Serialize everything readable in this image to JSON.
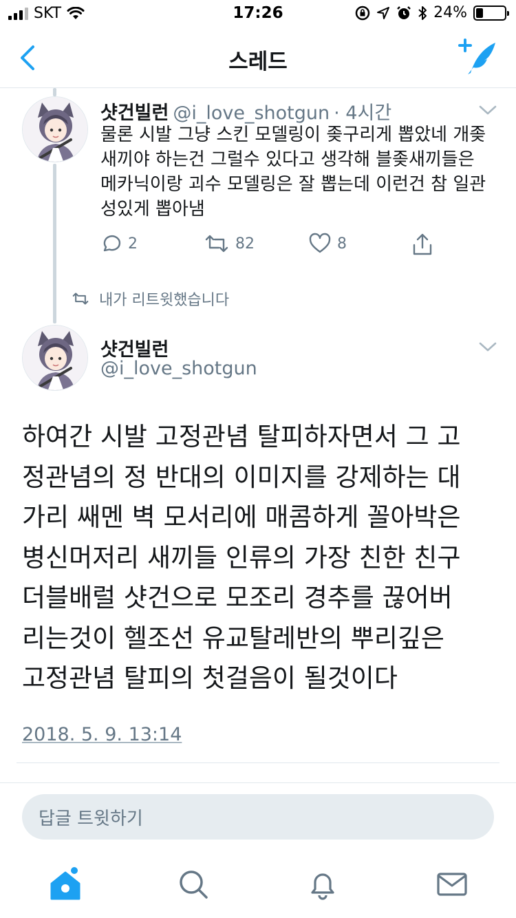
{
  "status_bar": {
    "carrier": "SKT",
    "time": "17:26",
    "battery": "24%",
    "battery_level": 0.24
  },
  "nav": {
    "title": "스레드",
    "back_icon": "chevron-left-icon",
    "compose_icon": "compose-tweet-icon"
  },
  "parent_tweet": {
    "display_name": "샷건빌런",
    "handle": "@i_love_shotgun",
    "time_ago": "· 4시간",
    "text_lines": [
      "물론 시발 그냥 스킨 모델링이 좆구리게 뽑았네 개좆",
      "새끼야 하는건 그럴수 있다고 생각해 블좆새끼들은",
      "메카닉이랑 괴수 모델링은 잘 뽑는데 이런건 참 일관",
      "성있게 뽑아냄"
    ],
    "reply_count": "2",
    "retweet_count": "82",
    "like_count": "8"
  },
  "retweet_notice": "내가 리트윗했습니다",
  "focus_tweet": {
    "display_name": "샷건빌런",
    "handle": "@i_love_shotgun",
    "text_lines": [
      "하여간 시발 고정관념 탈피하자면서 그 고",
      "정관념의 정 반대의 이미지를 강제하는 대",
      "가리 쌔멘 벽 모서리에 매콤하게 꼴아박은",
      "병신머저리 새끼들 인류의 가장 친한 친구",
      "더블배럴 샷건으로 모조리 경추를 끊어버",
      "리는것이 헬조선 유교탈레반의 뿌리깊은",
      "고정관념 탈피의 첫걸음이 될것이다"
    ],
    "timestamp": "2018. 5. 9. 13:14"
  },
  "reply_box": {
    "placeholder": "답글 트윗하기"
  },
  "colors": {
    "accent": "#1da1f2",
    "muted": "#657786",
    "border": "#e1e8ed",
    "reply_bg": "#e6ecf0"
  }
}
